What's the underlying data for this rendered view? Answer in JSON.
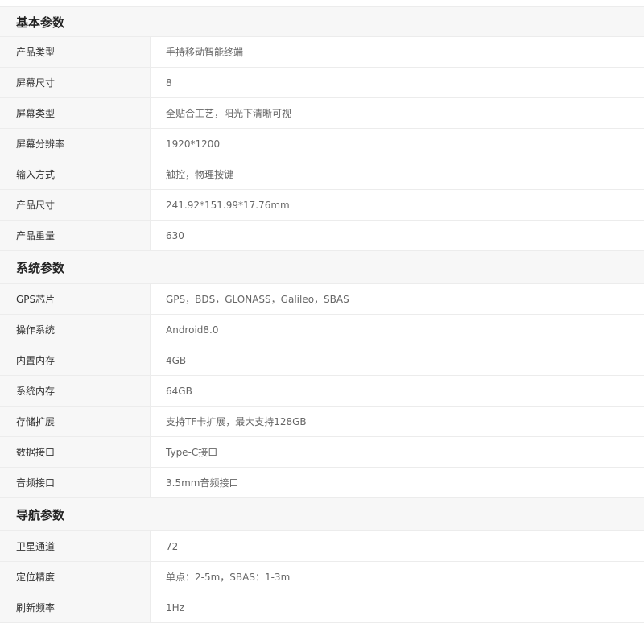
{
  "sections": [
    {
      "title": "基本参数",
      "rows": [
        {
          "label": "产品类型",
          "value": "手持移动智能终端"
        },
        {
          "label": "屏幕尺寸",
          "value": "8"
        },
        {
          "label": "屏幕类型",
          "value": "全贴合工艺，阳光下清晰可视"
        },
        {
          "label": "屏幕分辨率",
          "value": "1920*1200"
        },
        {
          "label": "输入方式",
          "value": "触控，物理按键"
        },
        {
          "label": "产品尺寸",
          "value": "241.92*151.99*17.76mm"
        },
        {
          "label": "产品重量",
          "value": "630"
        }
      ]
    },
    {
      "title": "系统参数",
      "rows": [
        {
          "label": "GPS芯片",
          "value": "GPS，BDS，GLONASS，Galileo，SBAS"
        },
        {
          "label": "操作系统",
          "value": "Android8.0"
        },
        {
          "label": "内置内存",
          "value": "4GB"
        },
        {
          "label": "系统内存",
          "value": "64GB"
        },
        {
          "label": "存储扩展",
          "value": "支持TF卡扩展，最大支持128GB"
        },
        {
          "label": "数据接口",
          "value": "Type-C接口"
        },
        {
          "label": "音频接口",
          "value": "3.5mm音频接口"
        }
      ]
    },
    {
      "title": "导航参数",
      "rows": [
        {
          "label": "卫星通道",
          "value": "72"
        },
        {
          "label": "定位精度",
          "value": "单点：2-5m，SBAS：1-3m"
        },
        {
          "label": "刷新频率",
          "value": "1Hz"
        }
      ]
    }
  ]
}
